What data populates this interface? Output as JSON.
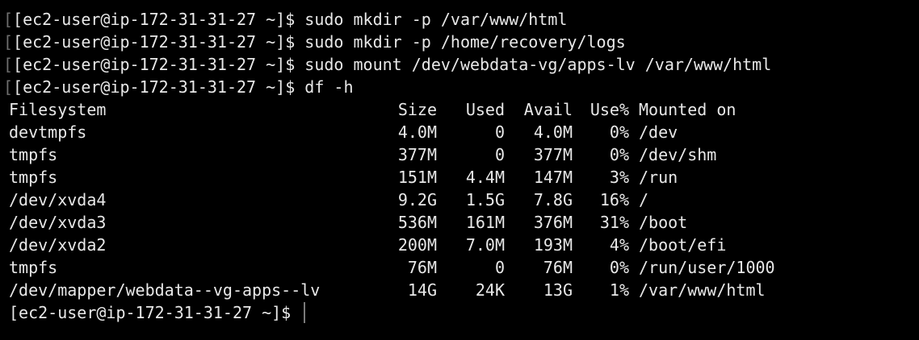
{
  "terminal": {
    "history": [
      {
        "marker": "[",
        "prompt": "[ec2-user@ip-172-31-31-27 ~]$",
        "command": "sudo mkdir -p /var/www/html"
      },
      {
        "marker": "[",
        "prompt": "[ec2-user@ip-172-31-31-27 ~]$",
        "command": "sudo mkdir -p /home/recovery/logs"
      },
      {
        "marker": "[",
        "prompt": "[ec2-user@ip-172-31-31-27 ~]$",
        "command": "sudo mount /dev/webdata-vg/apps-lv /var/www/html"
      },
      {
        "marker": "[",
        "prompt": "[ec2-user@ip-172-31-31-27 ~]$",
        "command": "df -h"
      }
    ],
    "df": {
      "headers": {
        "filesystem": "Filesystem",
        "size": "Size",
        "used": "Used",
        "avail": "Avail",
        "use_pct": "Use%",
        "mounted": "Mounted on"
      },
      "rows": [
        {
          "filesystem": "devtmpfs",
          "size": "4.0M",
          "used": "0",
          "avail": "4.0M",
          "use_pct": "0%",
          "mounted": "/dev"
        },
        {
          "filesystem": "tmpfs",
          "size": "377M",
          "used": "0",
          "avail": "377M",
          "use_pct": "0%",
          "mounted": "/dev/shm"
        },
        {
          "filesystem": "tmpfs",
          "size": "151M",
          "used": "4.4M",
          "avail": "147M",
          "use_pct": "3%",
          "mounted": "/run"
        },
        {
          "filesystem": "/dev/xvda4",
          "size": "9.2G",
          "used": "1.5G",
          "avail": "7.8G",
          "use_pct": "16%",
          "mounted": "/"
        },
        {
          "filesystem": "/dev/xvda3",
          "size": "536M",
          "used": "161M",
          "avail": "376M",
          "use_pct": "31%",
          "mounted": "/boot"
        },
        {
          "filesystem": "/dev/xvda2",
          "size": "200M",
          "used": "7.0M",
          "avail": "193M",
          "use_pct": "4%",
          "mounted": "/boot/efi"
        },
        {
          "filesystem": "tmpfs",
          "size": "76M",
          "used": "0",
          "avail": "76M",
          "use_pct": "0%",
          "mounted": "/run/user/1000"
        },
        {
          "filesystem": "/dev/mapper/webdata--vg-apps--lv",
          "size": "14G",
          "used": "24K",
          "avail": "13G",
          "use_pct": "1%",
          "mounted": "/var/www/html"
        }
      ]
    },
    "current_prompt": "[ec2-user@ip-172-31-31-27 ~]$",
    "colors": {
      "background": "#000000",
      "text": "#e8e8e8",
      "marker": "#6f6f6f",
      "cursor": "#7a7a7a"
    }
  }
}
